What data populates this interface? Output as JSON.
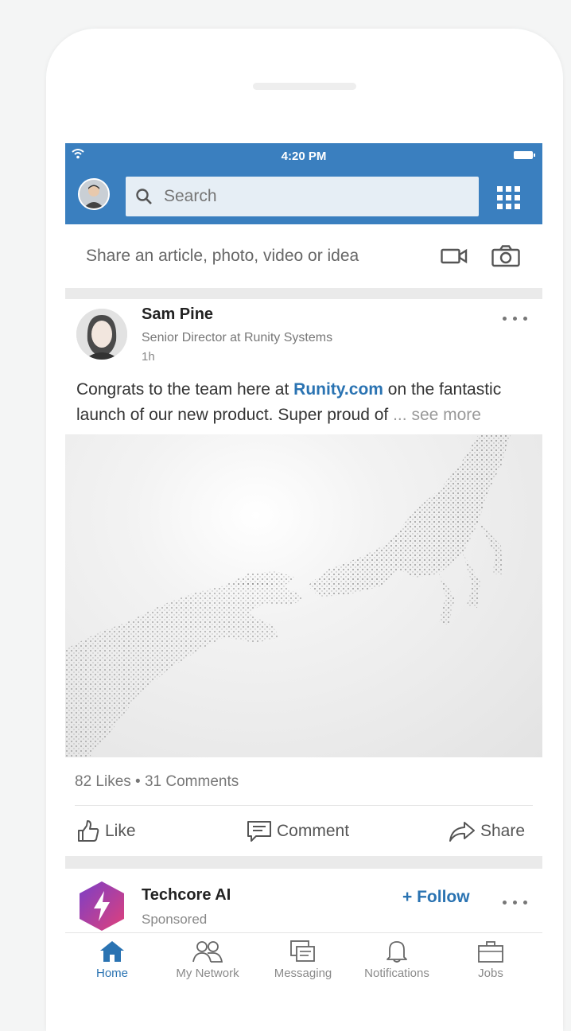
{
  "colors": {
    "brand_blue": "#3a7fbf",
    "link_blue": "#2a73b2",
    "company_gradient": [
      "#7b3fc7",
      "#e0407a"
    ]
  },
  "status_bar": {
    "time": "4:20 PM"
  },
  "header": {
    "search_placeholder": "Search"
  },
  "composer": {
    "prompt": "Share an article, photo, video or idea"
  },
  "post": {
    "author": "Sam Pine",
    "headline": "Senior Director at Runity Systems",
    "time": "1h",
    "text_before": "Congrats to the team here at ",
    "link": "Runity.com",
    "text_after": " on the fantastic launch of our new product. Super proud of",
    "ellipsis": " ...",
    "see_more": " see more",
    "counts": "82 Likes • 31 Comments",
    "actions": {
      "like": "Like",
      "comment": "Comment",
      "share": "Share"
    }
  },
  "sponsored_post": {
    "company": "Techcore AI",
    "label": "Sponsored",
    "follow": "+ Follow"
  },
  "tabs": [
    {
      "label": "Home",
      "icon": "home-icon",
      "active": true
    },
    {
      "label": "My Network",
      "icon": "network-icon",
      "active": false
    },
    {
      "label": "Messaging",
      "icon": "messaging-icon",
      "active": false
    },
    {
      "label": "Notifications",
      "icon": "bell-icon",
      "active": false
    },
    {
      "label": "Jobs",
      "icon": "briefcase-icon",
      "active": false
    }
  ]
}
